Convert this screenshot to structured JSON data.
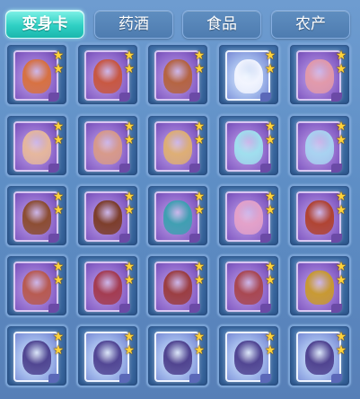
{
  "tabs": [
    {
      "label": "变身卡",
      "active": true
    },
    {
      "label": "药酒",
      "active": false
    },
    {
      "label": "食品",
      "active": false
    },
    {
      "label": "农产",
      "active": false
    }
  ],
  "colors": {
    "active_tab": "#2fd0c4",
    "tab": "#4e7cb0",
    "panel": "#5d8dc4",
    "slot": "#3f6fa8",
    "star": "#ffd23a"
  },
  "grid": {
    "rows": [
      [
        {
          "card": "purple",
          "figure_color": "#d9703a",
          "stars": 2
        },
        {
          "card": "purple",
          "figure_color": "#c9553a",
          "stars": 2
        },
        {
          "card": "purple",
          "figure_color": "#b5623a",
          "stars": 2
        },
        {
          "card": "blue",
          "figure_color": "#f4f6ff",
          "stars": 2
        },
        {
          "card": "purple",
          "figure_color": "#e49aa8",
          "stars": 2
        }
      ],
      [
        {
          "card": "purple",
          "figure_color": "#e8b99a",
          "stars": 2
        },
        {
          "card": "purple",
          "figure_color": "#d99a86",
          "stars": 2
        },
        {
          "card": "purple",
          "figure_color": "#e0b070",
          "stars": 2
        },
        {
          "card": "purple",
          "figure_color": "#9fe3ef",
          "stars": 2
        },
        {
          "card": "purple",
          "figure_color": "#a8d6f2",
          "stars": 2
        }
      ],
      [
        {
          "card": "purple",
          "figure_color": "#8a4a2a",
          "stars": 2
        },
        {
          "card": "purple",
          "figure_color": "#7a3a22",
          "stars": 2
        },
        {
          "card": "purple",
          "figure_color": "#3aa0b0",
          "stars": 2
        },
        {
          "card": "purple",
          "figure_color": "#e6a2c8",
          "stars": 2
        },
        {
          "card": "purple",
          "figure_color": "#b0402a",
          "stars": 2
        }
      ],
      [
        {
          "card": "purple",
          "figure_color": "#b8584a",
          "stars": 2
        },
        {
          "card": "purple",
          "figure_color": "#a3384a",
          "stars": 2
        },
        {
          "card": "purple",
          "figure_color": "#9a3a3a",
          "stars": 2
        },
        {
          "card": "purple",
          "figure_color": "#a8444a",
          "stars": 2
        },
        {
          "card": "purple",
          "figure_color": "#c99a2a",
          "stars": 2
        }
      ],
      [
        {
          "card": "blue",
          "figure_color": "#4a3e8c",
          "stars": 2
        },
        {
          "card": "blue",
          "figure_color": "#4c3f8f",
          "stars": 2
        },
        {
          "card": "blue",
          "figure_color": "#4a3c8a",
          "stars": 2
        },
        {
          "card": "blue",
          "figure_color": "#4b3e8d",
          "stars": 2
        },
        {
          "card": "blue",
          "figure_color": "#4a3c8b",
          "stars": 2
        }
      ]
    ]
  },
  "icons": {
    "star": "★"
  }
}
